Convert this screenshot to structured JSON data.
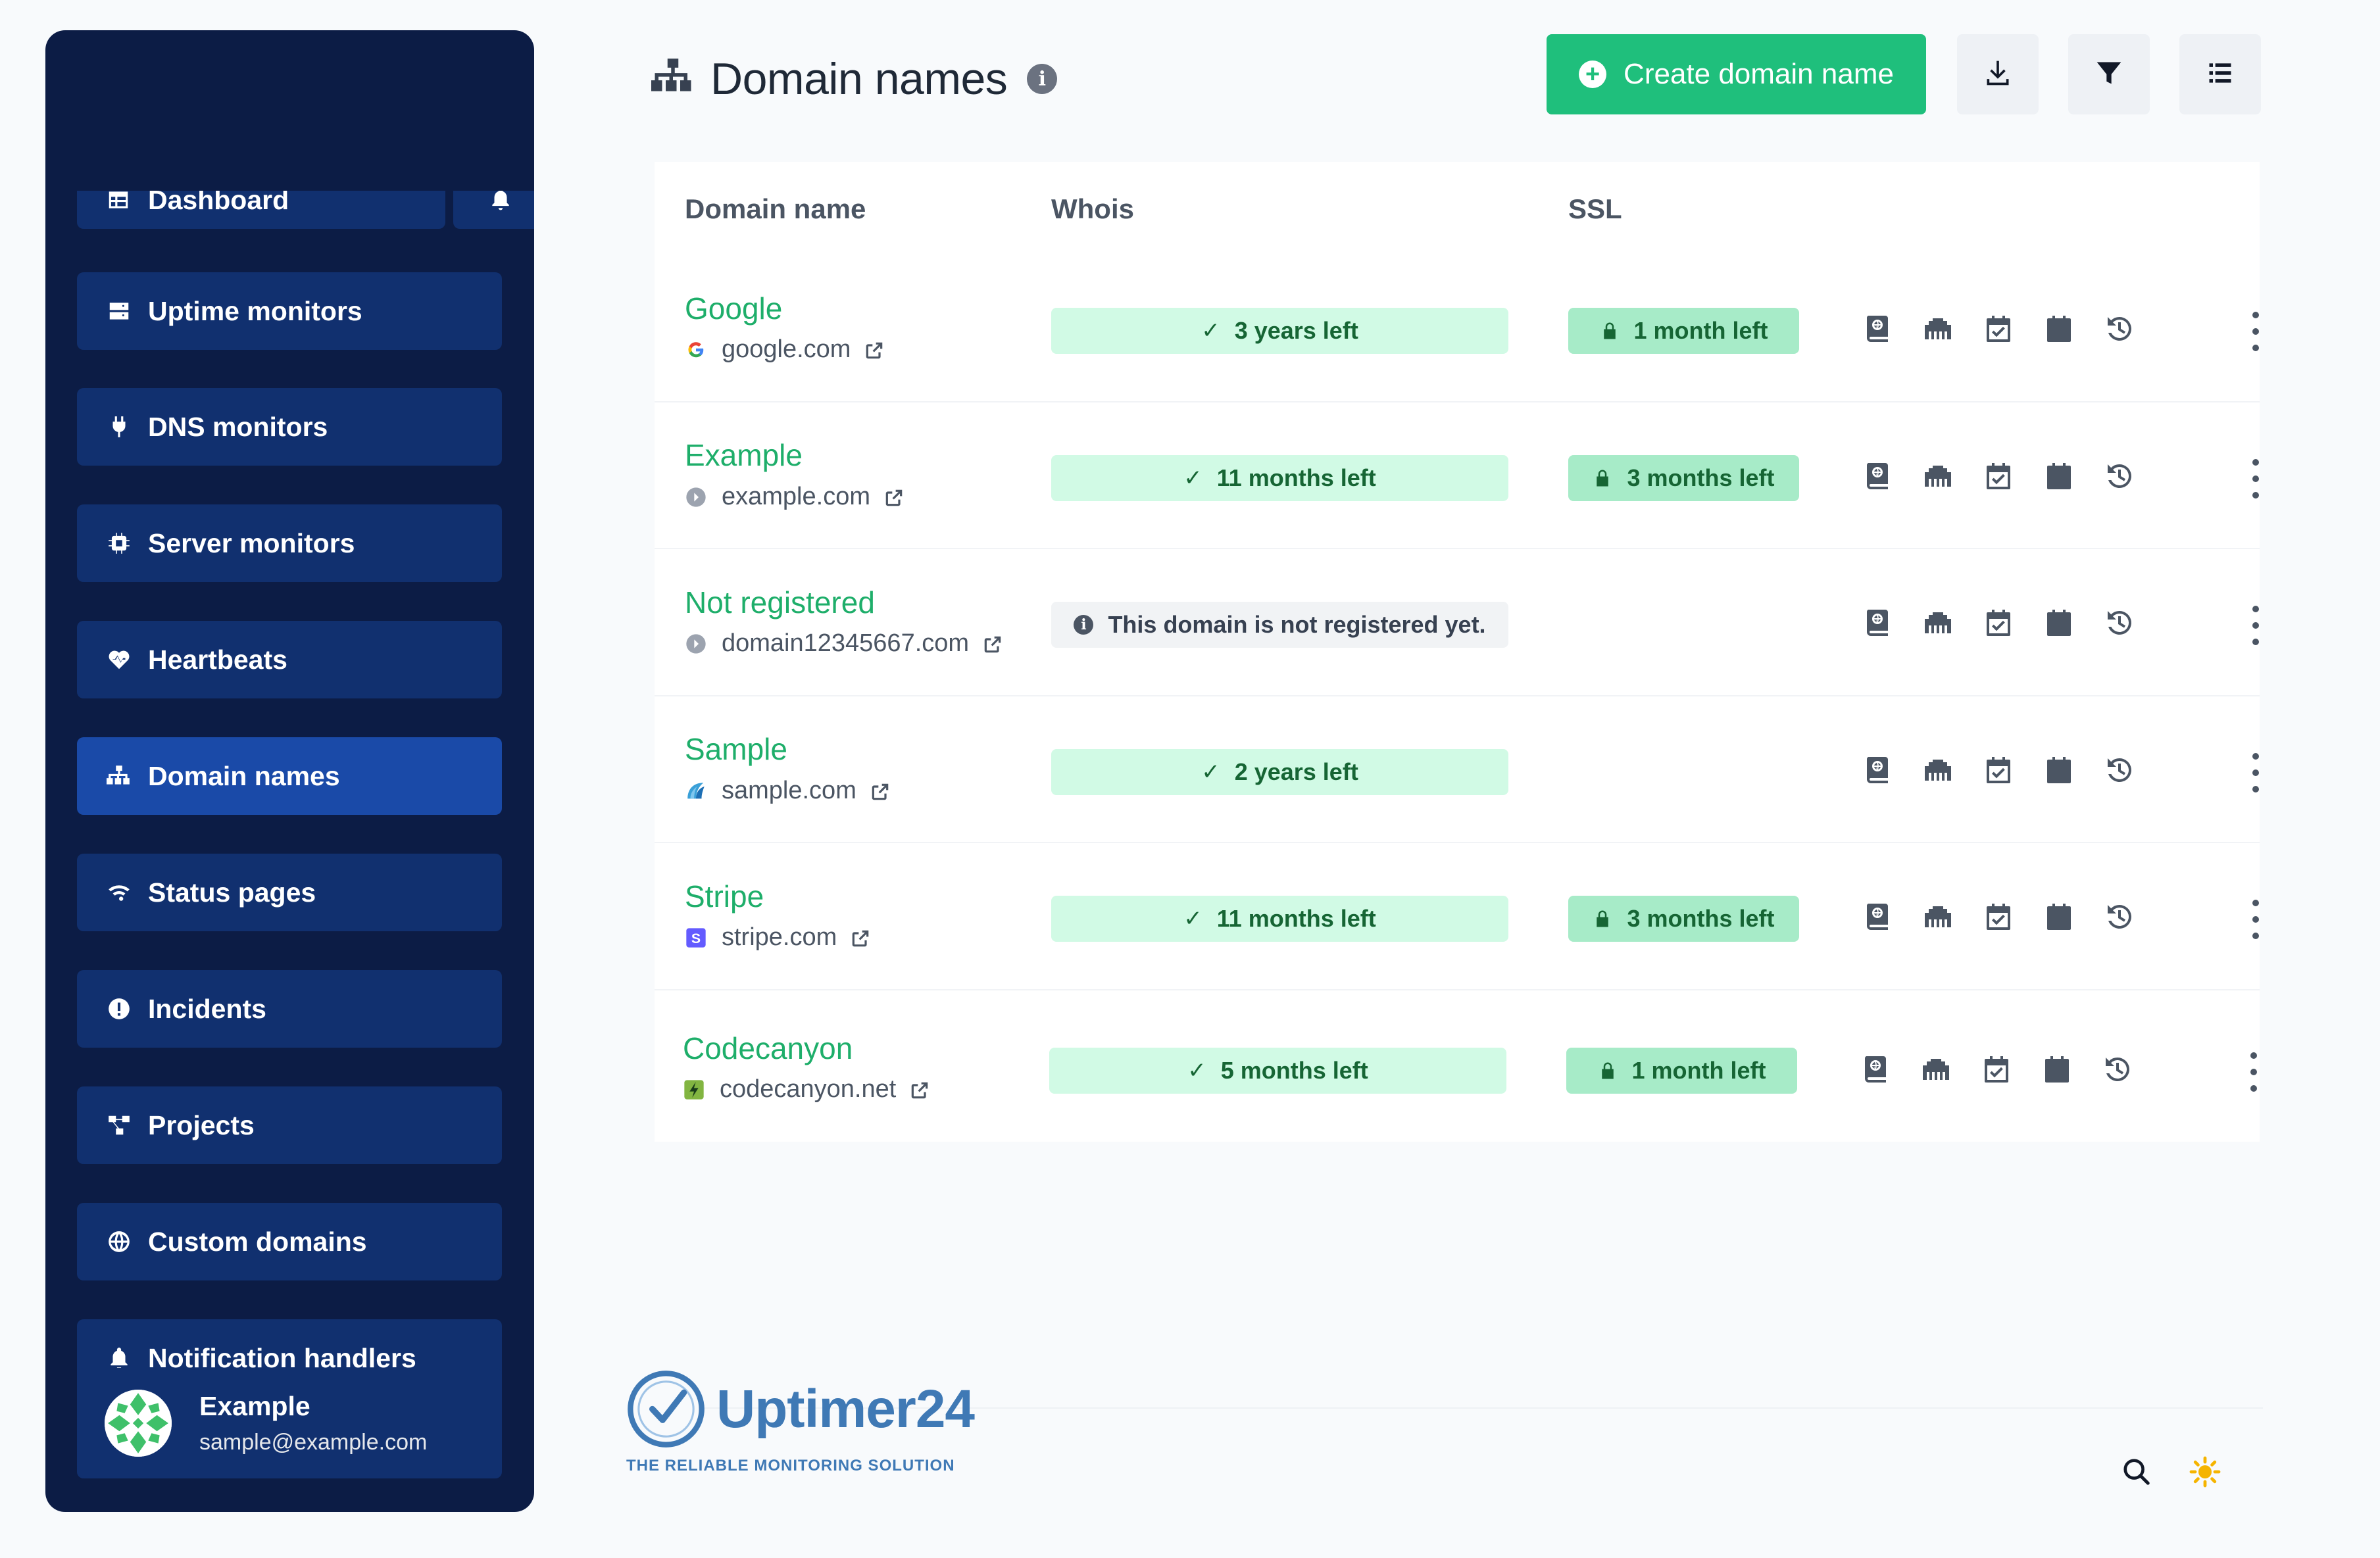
{
  "sidebar": {
    "items": [
      {
        "label": "Dashboard",
        "icon": "table-icon"
      },
      {
        "label": "Uptime monitors",
        "icon": "server-icon"
      },
      {
        "label": "DNS monitors",
        "icon": "plug-icon"
      },
      {
        "label": "Server monitors",
        "icon": "cpu-icon"
      },
      {
        "label": "Heartbeats",
        "icon": "heart-pulse-icon"
      },
      {
        "label": "Domain names",
        "icon": "network-icon",
        "active": true
      },
      {
        "label": "Status pages",
        "icon": "wifi-icon"
      },
      {
        "label": "Incidents",
        "icon": "exclamation-circle-icon"
      },
      {
        "label": "Projects",
        "icon": "project-diagram-icon"
      },
      {
        "label": "Custom domains",
        "icon": "globe-icon"
      },
      {
        "label": "Notification handlers",
        "icon": "bell-icon"
      }
    ],
    "user": {
      "name": "Example",
      "email": "sample@example.com"
    }
  },
  "header": {
    "title": "Domain names",
    "create_label": "Create domain name"
  },
  "table": {
    "headers": {
      "domain": "Domain name",
      "whois": "Whois",
      "ssl": "SSL"
    },
    "rows": [
      {
        "name": "Google",
        "url": "google.com",
        "whois": "3 years left",
        "ssl": "1 month left"
      },
      {
        "name": "Example",
        "url": "example.com",
        "whois": "11 months left",
        "ssl": "3 months left"
      },
      {
        "name": "Not registered",
        "url": "domain12345667.com",
        "whois": "This domain is not registered yet.",
        "ssl": ""
      },
      {
        "name": "Sample",
        "url": "sample.com",
        "whois": "2 years left",
        "ssl": ""
      },
      {
        "name": "Stripe",
        "url": "stripe.com",
        "whois": "11 months left",
        "ssl": "3 months left"
      },
      {
        "name": "Codecanyon",
        "url": "codecanyon.net",
        "whois": "5 months left",
        "ssl": "1 month left"
      }
    ]
  },
  "footer": {
    "brand": "Uptimer24",
    "tagline": "THE RELIABLE MONITORING SOLUTION"
  },
  "colors": {
    "sidebar_bg": "#0c1c45",
    "accent_green": "#1fbf7c",
    "link_green": "#1eae6a",
    "brand_blue": "#3f79b5"
  }
}
